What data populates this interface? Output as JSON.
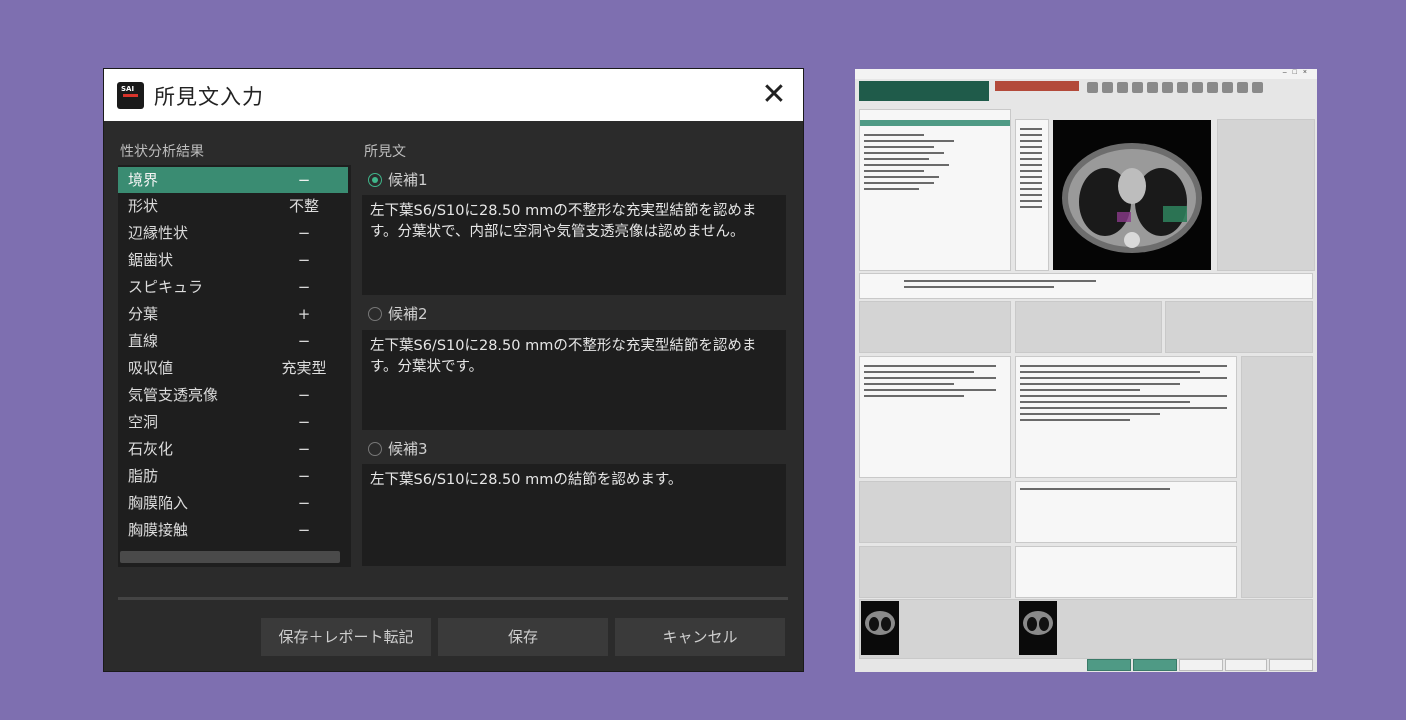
{
  "dialog": {
    "title": "所見文入力",
    "icon_label": "SAI",
    "analysis_section_label": "性状分析結果",
    "finding_section_label": "所見文",
    "analysis_rows": [
      {
        "key": "境界",
        "value": "−",
        "selected": true
      },
      {
        "key": "形状",
        "value": "不整"
      },
      {
        "key": "辺縁性状",
        "value": "−"
      },
      {
        "key": "鋸歯状",
        "value": "−"
      },
      {
        "key": "スピキュラ",
        "value": "−"
      },
      {
        "key": "分葉",
        "value": "+"
      },
      {
        "key": "直線",
        "value": "−"
      },
      {
        "key": "吸収値",
        "value": "充実型"
      },
      {
        "key": "気管支透亮像",
        "value": "−"
      },
      {
        "key": "空洞",
        "value": "−"
      },
      {
        "key": "石灰化",
        "value": "−"
      },
      {
        "key": "脂肪",
        "value": "−"
      },
      {
        "key": "胸膜陥入",
        "value": "−"
      },
      {
        "key": "胸膜接触",
        "value": "−"
      }
    ],
    "candidates": [
      {
        "label": "候補1",
        "selected": true,
        "text": "左下葉S6/S10に28.50 mmの不整形な充実型結節を認めます。分葉状で、内部に空洞や気管支透亮像は認めません。"
      },
      {
        "label": "候補2",
        "selected": false,
        "text": "左下葉S6/S10に28.50 mmの不整形な充実型結節を認めます。分葉状です。"
      },
      {
        "label": "候補3",
        "selected": false,
        "text": "左下葉S6/S10に28.50 mmの結節を認めます。"
      }
    ],
    "buttons": {
      "save_and_report": "保存＋レポート転記",
      "save": "保存",
      "cancel": "キャンセル"
    }
  },
  "colors": {
    "background": "#7e6fb0",
    "dialog_bg": "#2b2b2b",
    "selected_row": "#3a8c72",
    "accent_green": "#3fb58a"
  }
}
